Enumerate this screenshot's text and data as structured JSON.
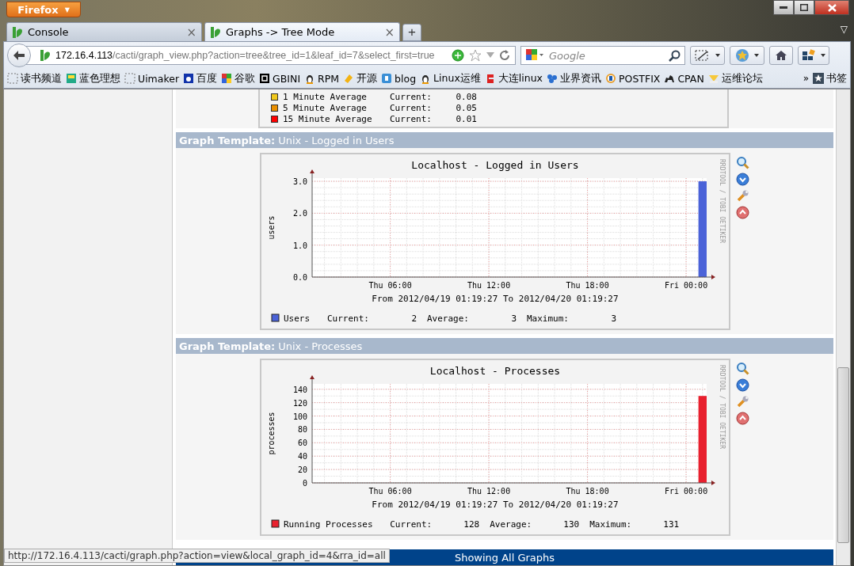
{
  "window": {
    "app_button": "Firefox",
    "app_button_caret": "▼"
  },
  "tabs": [
    {
      "label": "Console",
      "selected": false,
      "close": "×"
    },
    {
      "label": "Graphs -> Tree Mode",
      "selected": true,
      "close": "×"
    }
  ],
  "new_tab": "+",
  "tab_list": "▽",
  "address_bar": {
    "url_host": "172.16.4.113",
    "url_path": "/cacti/graph_view.php?action=tree&tree_id=1&leaf_id=7&select_first=true"
  },
  "search": {
    "placeholder": "Google"
  },
  "bookmarks": [
    {
      "label": "读书频道"
    },
    {
      "label": "蓝色理想"
    },
    {
      "label": "Uimaker"
    },
    {
      "label": "百度"
    },
    {
      "label": "谷歌"
    },
    {
      "label": "GBINI"
    },
    {
      "label": "RPM"
    },
    {
      "label": "开源"
    },
    {
      "label": "blog"
    },
    {
      "label": "Linux运维"
    },
    {
      "label": "大连linux"
    },
    {
      "label": "业界资讯"
    },
    {
      "label": "POSTFIX"
    },
    {
      "label": "CPAN"
    },
    {
      "label": "运维论坛"
    }
  ],
  "bookmarks_more": "»",
  "bookmarks_menu": "书签",
  "partial_legend": [
    {
      "label": "1 Minute Average",
      "stat": "Current:",
      "value": "0.08",
      "color": "#f0c81c"
    },
    {
      "label": "5 Minute Average",
      "stat": "Current:",
      "value": "0.05",
      "color": "#ea8f00"
    },
    {
      "label": "15 Minute Average",
      "stat": "Current:",
      "value": "0.01",
      "color": "#ff0000"
    }
  ],
  "sections": [
    {
      "header_label": "Graph Template:",
      "header_value": "Unix - Logged in Users",
      "credit": "RRDTOOL / TOBI OETIKER",
      "chart_data": {
        "type": "bar",
        "grid": true,
        "title": "Localhost - Logged in Users",
        "xlabel": "From 2012/04/19 01:19:27 To 2012/04/20 01:19:27",
        "ylabel": "users",
        "categories": [
          null,
          null,
          null,
          null,
          null,
          null,
          null,
          null,
          null,
          "Thu 06:00",
          null,
          null,
          null,
          null,
          null,
          null,
          null,
          null,
          null,
          null,
          null,
          "Thu 12:00",
          null,
          null,
          null,
          null,
          null,
          null,
          null,
          null,
          null,
          null,
          null,
          "Thu 18:00",
          null,
          null,
          null,
          null,
          null,
          null,
          null,
          null,
          null,
          null,
          null,
          "Fri 00:00",
          null,
          null
        ],
        "series": [
          {
            "name": "Users",
            "color": "#4a62d8",
            "values": [
              null,
              null,
              null,
              null,
              null,
              null,
              null,
              null,
              null,
              null,
              null,
              null,
              null,
              null,
              null,
              null,
              null,
              null,
              null,
              null,
              null,
              null,
              null,
              null,
              null,
              null,
              null,
              null,
              null,
              null,
              null,
              null,
              null,
              null,
              null,
              null,
              null,
              null,
              null,
              null,
              null,
              null,
              null,
              null,
              null,
              null,
              null,
              3
            ]
          }
        ],
        "ylim": [
          0,
          3.1
        ],
        "yticks": [
          {
            "value": 0,
            "label": "0.0"
          },
          {
            "value": 1,
            "label": "1.0"
          },
          {
            "value": 2,
            "label": "2.0"
          },
          {
            "value": 3,
            "label": "3.0"
          }
        ]
      },
      "legend": [
        {
          "stats": [
            {
              "label": "Current:",
              "value": "2"
            },
            {
              "label": "Average:",
              "value": "3"
            },
            {
              "label": "Maximum:",
              "value": "3"
            }
          ]
        }
      ]
    },
    {
      "header_label": "Graph Template:",
      "header_value": "Unix - Processes",
      "credit": "RRDTOOL / TOBI OETIKER",
      "chart_data": {
        "type": "bar",
        "grid": true,
        "title": "Localhost - Processes",
        "xlabel": "From 2012/04/19 01:19:27 To 2012/04/20 01:19:27",
        "ylabel": "processes",
        "categories": [
          null,
          null,
          null,
          null,
          null,
          null,
          null,
          null,
          null,
          "Thu 06:00",
          null,
          null,
          null,
          null,
          null,
          null,
          null,
          null,
          null,
          null,
          null,
          "Thu 12:00",
          null,
          null,
          null,
          null,
          null,
          null,
          null,
          null,
          null,
          null,
          null,
          "Thu 18:00",
          null,
          null,
          null,
          null,
          null,
          null,
          null,
          null,
          null,
          null,
          null,
          "Fri 00:00",
          null,
          null
        ],
        "series": [
          {
            "name": "Running Processes",
            "color": "#e8202e",
            "values": [
              null,
              null,
              null,
              null,
              null,
              null,
              null,
              null,
              null,
              null,
              null,
              null,
              null,
              null,
              null,
              null,
              null,
              null,
              null,
              null,
              null,
              null,
              null,
              null,
              null,
              null,
              null,
              null,
              null,
              null,
              null,
              null,
              null,
              null,
              null,
              null,
              null,
              null,
              null,
              null,
              null,
              null,
              null,
              null,
              null,
              null,
              null,
              130
            ]
          }
        ],
        "ylim": [
          0,
          148
        ],
        "yticks": [
          0,
          20,
          40,
          60,
          80,
          100,
          120,
          140
        ]
      },
      "legend": [
        {
          "stats": [
            {
              "label": "Current:",
              "value": "128"
            },
            {
              "label": "Average:",
              "value": "130"
            },
            {
              "label": "Maximum:",
              "value": "131"
            }
          ]
        }
      ]
    }
  ],
  "footer": "Showing All Graphs",
  "status_bar": "http://172.16.4.113/cacti/graph.php?action=view&local_graph_id=4&rra_id=all"
}
